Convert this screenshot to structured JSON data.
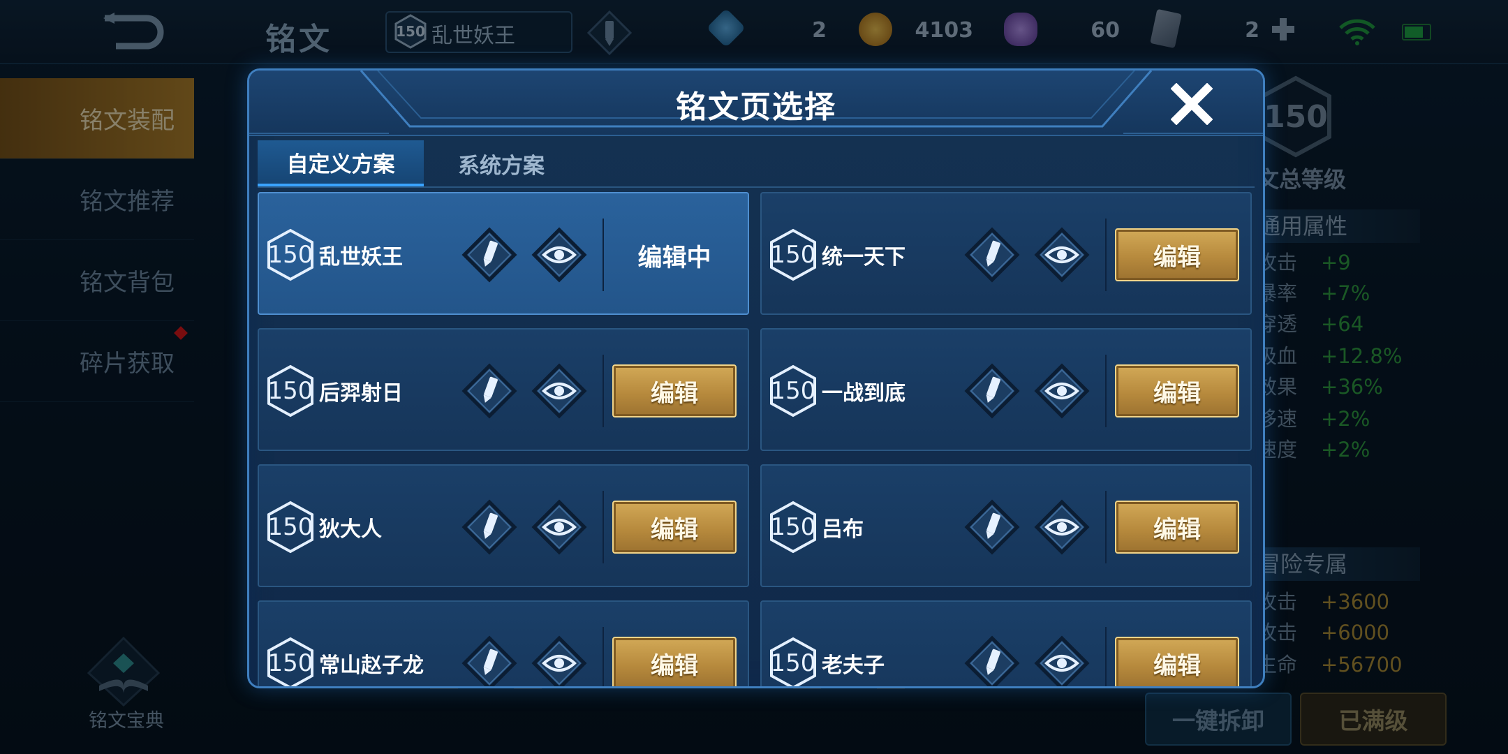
{
  "top_bar": {
    "title": "铭文",
    "current_page_level": "150",
    "current_page_name": "乱世妖王",
    "resources": [
      {
        "icon": "blue-crystal-icon",
        "value": "2",
        "color": "#3b8fd0"
      },
      {
        "icon": "gold-coin-icon",
        "value": "4103",
        "color": "#d89a25"
      },
      {
        "icon": "purple-gem-icon",
        "value": "60",
        "color": "#8a5fc6"
      },
      {
        "icon": "card-icon",
        "value": "2",
        "color": "#7f8fa3"
      }
    ]
  },
  "left_nav": {
    "items": [
      {
        "label": "铭文装配",
        "active": true
      },
      {
        "label": "铭文推荐",
        "active": false
      },
      {
        "label": "铭文背包",
        "active": false
      },
      {
        "label": "碎片获取",
        "active": false
      }
    ],
    "codex_label": "铭文宝典"
  },
  "right_panel": {
    "level": "150",
    "total_level_label": "文总等级",
    "general_header": "通用属性",
    "general_stats": [
      {
        "key": "攻击",
        "value": "+9"
      },
      {
        "key": "暴率",
        "value": "+7%"
      },
      {
        "key": "穿透",
        "value": "+64"
      },
      {
        "key": "吸血",
        "value": "+12.8%"
      },
      {
        "key": "效果",
        "value": "+36%"
      },
      {
        "key": "移速",
        "value": "+2%"
      },
      {
        "key": "速度",
        "value": "+2%"
      }
    ],
    "adventure_header": "冒险专属",
    "adventure_stats": [
      {
        "key": "攻击",
        "value": "+3600"
      },
      {
        "key": "攻击",
        "value": "+6000"
      },
      {
        "key": "生命",
        "value": "+56700"
      }
    ],
    "unequip_label": "一键拆卸",
    "max_level_label": "已满级"
  },
  "modal": {
    "title": "铭文页选择",
    "tabs": [
      {
        "label": "自定义方案",
        "active": true
      },
      {
        "label": "系统方案",
        "active": false
      }
    ],
    "edit_label": "编辑",
    "editing_label": "编辑中",
    "pages": [
      {
        "level": "150",
        "name": "乱世妖王",
        "status": "editing"
      },
      {
        "level": "150",
        "name": "统一天下",
        "status": "edit"
      },
      {
        "level": "150",
        "name": "后羿射日",
        "status": "edit"
      },
      {
        "level": "150",
        "name": "一战到底",
        "status": "edit"
      },
      {
        "level": "150",
        "name": "狄大人",
        "status": "edit"
      },
      {
        "level": "150",
        "name": "吕布",
        "status": "edit"
      },
      {
        "level": "150",
        "name": "常山赵子龙",
        "status": "edit"
      },
      {
        "level": "150",
        "name": "老夫子",
        "status": "edit"
      }
    ]
  }
}
